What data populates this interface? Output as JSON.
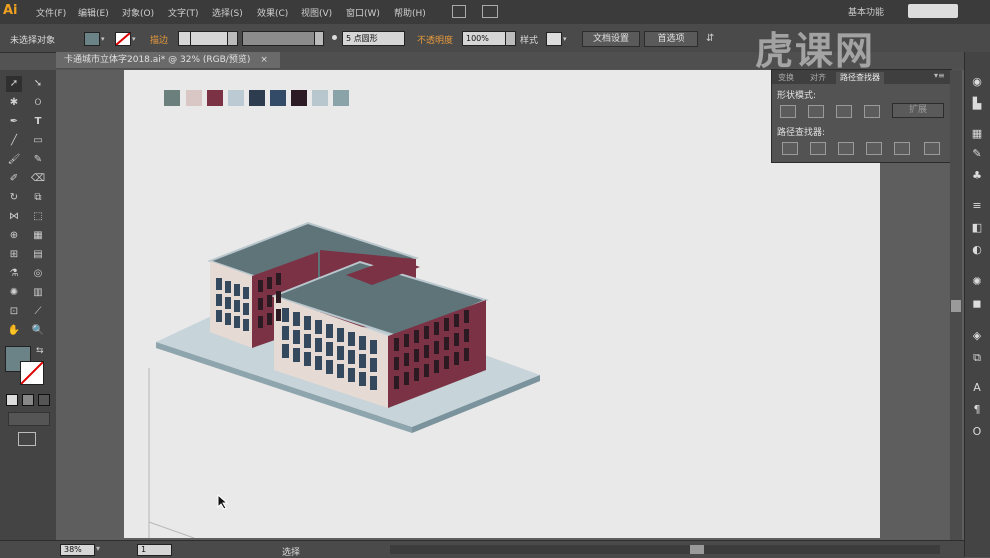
{
  "app": {
    "logo": "Ai",
    "workspace": "基本功能"
  },
  "menu": {
    "items": [
      "文件(F)",
      "编辑(E)",
      "对象(O)",
      "文字(T)",
      "选择(S)",
      "效果(C)",
      "视图(V)",
      "窗口(W)",
      "帮助(H)"
    ]
  },
  "control_bar": {
    "selection_status": "未选择对象",
    "stroke_label": "描边",
    "brush_label": "5 点圆形",
    "opacity_label": "不透明度",
    "opacity_value": "100%",
    "style_label": "样式",
    "doc_setup_button": "文档设置",
    "preferences_button": "首选项"
  },
  "document": {
    "tab_title": "卡通城市立体字2018.ai* @ 32% (RGB/预览)"
  },
  "panel": {
    "tabs": [
      "变换",
      "对齐",
      "路径查找器"
    ],
    "shape_modes_label": "形状模式:",
    "expand_button": "扩展",
    "pathfinders_label": "路径查找器:"
  },
  "palette": {
    "colors": [
      "#6b7f7c",
      "#d9c7c6",
      "#7b3244",
      "#bccbd3",
      "#2e3c50",
      "#334b67",
      "#2c1a24",
      "#b8c6ce",
      "#8aa3a8"
    ]
  },
  "colors": {
    "fill": "#6b8286",
    "wall_red": "#7b3244",
    "wall_light": "#e3d8d3",
    "window": "#34495e",
    "roof": "#6a7f83",
    "base": "#9db3bb"
  },
  "status": {
    "zoom": "38%",
    "artboard_index": "1",
    "tool_status": "选择"
  },
  "watermark": "虎课网"
}
